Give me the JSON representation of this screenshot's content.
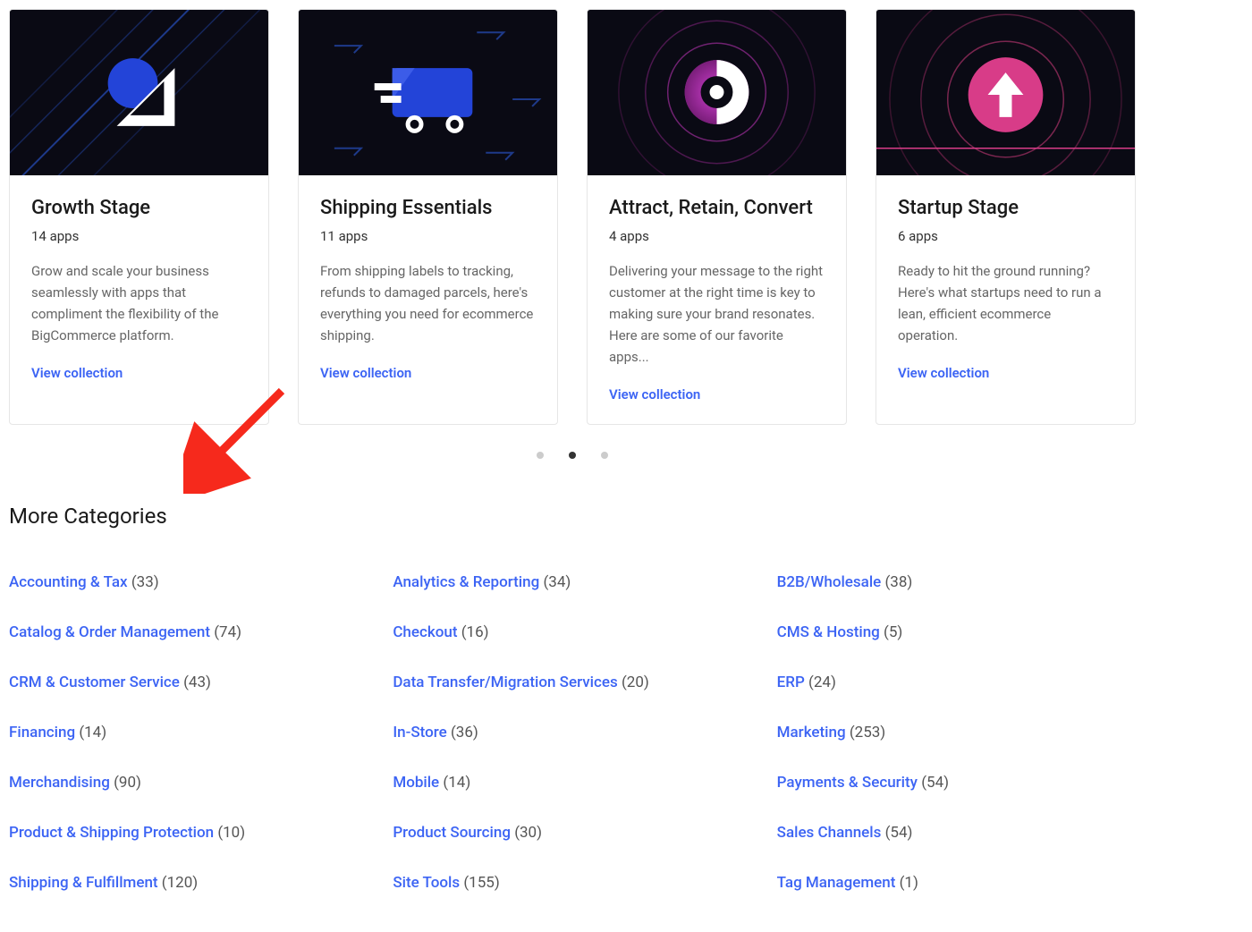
{
  "cards": [
    {
      "title": "Growth Stage",
      "apps": "14 apps",
      "desc": "Grow and scale your business seamlessly with apps that compliment the flexibility of the BigCommerce platform.",
      "link": "View collection"
    },
    {
      "title": "Shipping Essentials",
      "apps": "11 apps",
      "desc": "From shipping labels to tracking, refunds to damaged parcels, here's everything you need for ecommerce shipping.",
      "link": "View collection"
    },
    {
      "title": "Attract, Retain, Convert",
      "apps": "4 apps",
      "desc": "Delivering your message to the right customer at the right time is key to making sure your brand resonates. Here are some of our favorite apps...",
      "link": "View collection"
    },
    {
      "title": "Startup Stage",
      "apps": "6 apps",
      "desc": "Ready to hit the ground running? Here's what startups need to run a lean, efficient ecommerce operation.",
      "link": "View collection"
    }
  ],
  "section_title": "More Categories",
  "categories": [
    {
      "name": "Accounting & Tax",
      "count": "(33)"
    },
    {
      "name": "Analytics & Reporting",
      "count": "(34)"
    },
    {
      "name": "B2B/Wholesale",
      "count": "(38)"
    },
    {
      "name": "Catalog & Order Management",
      "count": "(74)"
    },
    {
      "name": "Checkout",
      "count": "(16)"
    },
    {
      "name": "CMS & Hosting",
      "count": "(5)"
    },
    {
      "name": "CRM & Customer Service",
      "count": "(43)"
    },
    {
      "name": "Data Transfer/Migration Services",
      "count": "(20)"
    },
    {
      "name": "ERP",
      "count": "(24)"
    },
    {
      "name": "Financing",
      "count": "(14)"
    },
    {
      "name": "In-Store",
      "count": "(36)"
    },
    {
      "name": "Marketing",
      "count": "(253)"
    },
    {
      "name": "Merchandising",
      "count": "(90)"
    },
    {
      "name": "Mobile",
      "count": "(14)"
    },
    {
      "name": "Payments & Security",
      "count": "(54)"
    },
    {
      "name": "Product & Shipping Protection",
      "count": "(10)"
    },
    {
      "name": "Product Sourcing",
      "count": "(30)"
    },
    {
      "name": "Sales Channels",
      "count": "(54)"
    },
    {
      "name": "Shipping & Fulfillment",
      "count": "(120)"
    },
    {
      "name": "Site Tools",
      "count": "(155)"
    },
    {
      "name": "Tag Management",
      "count": "(1)"
    }
  ]
}
